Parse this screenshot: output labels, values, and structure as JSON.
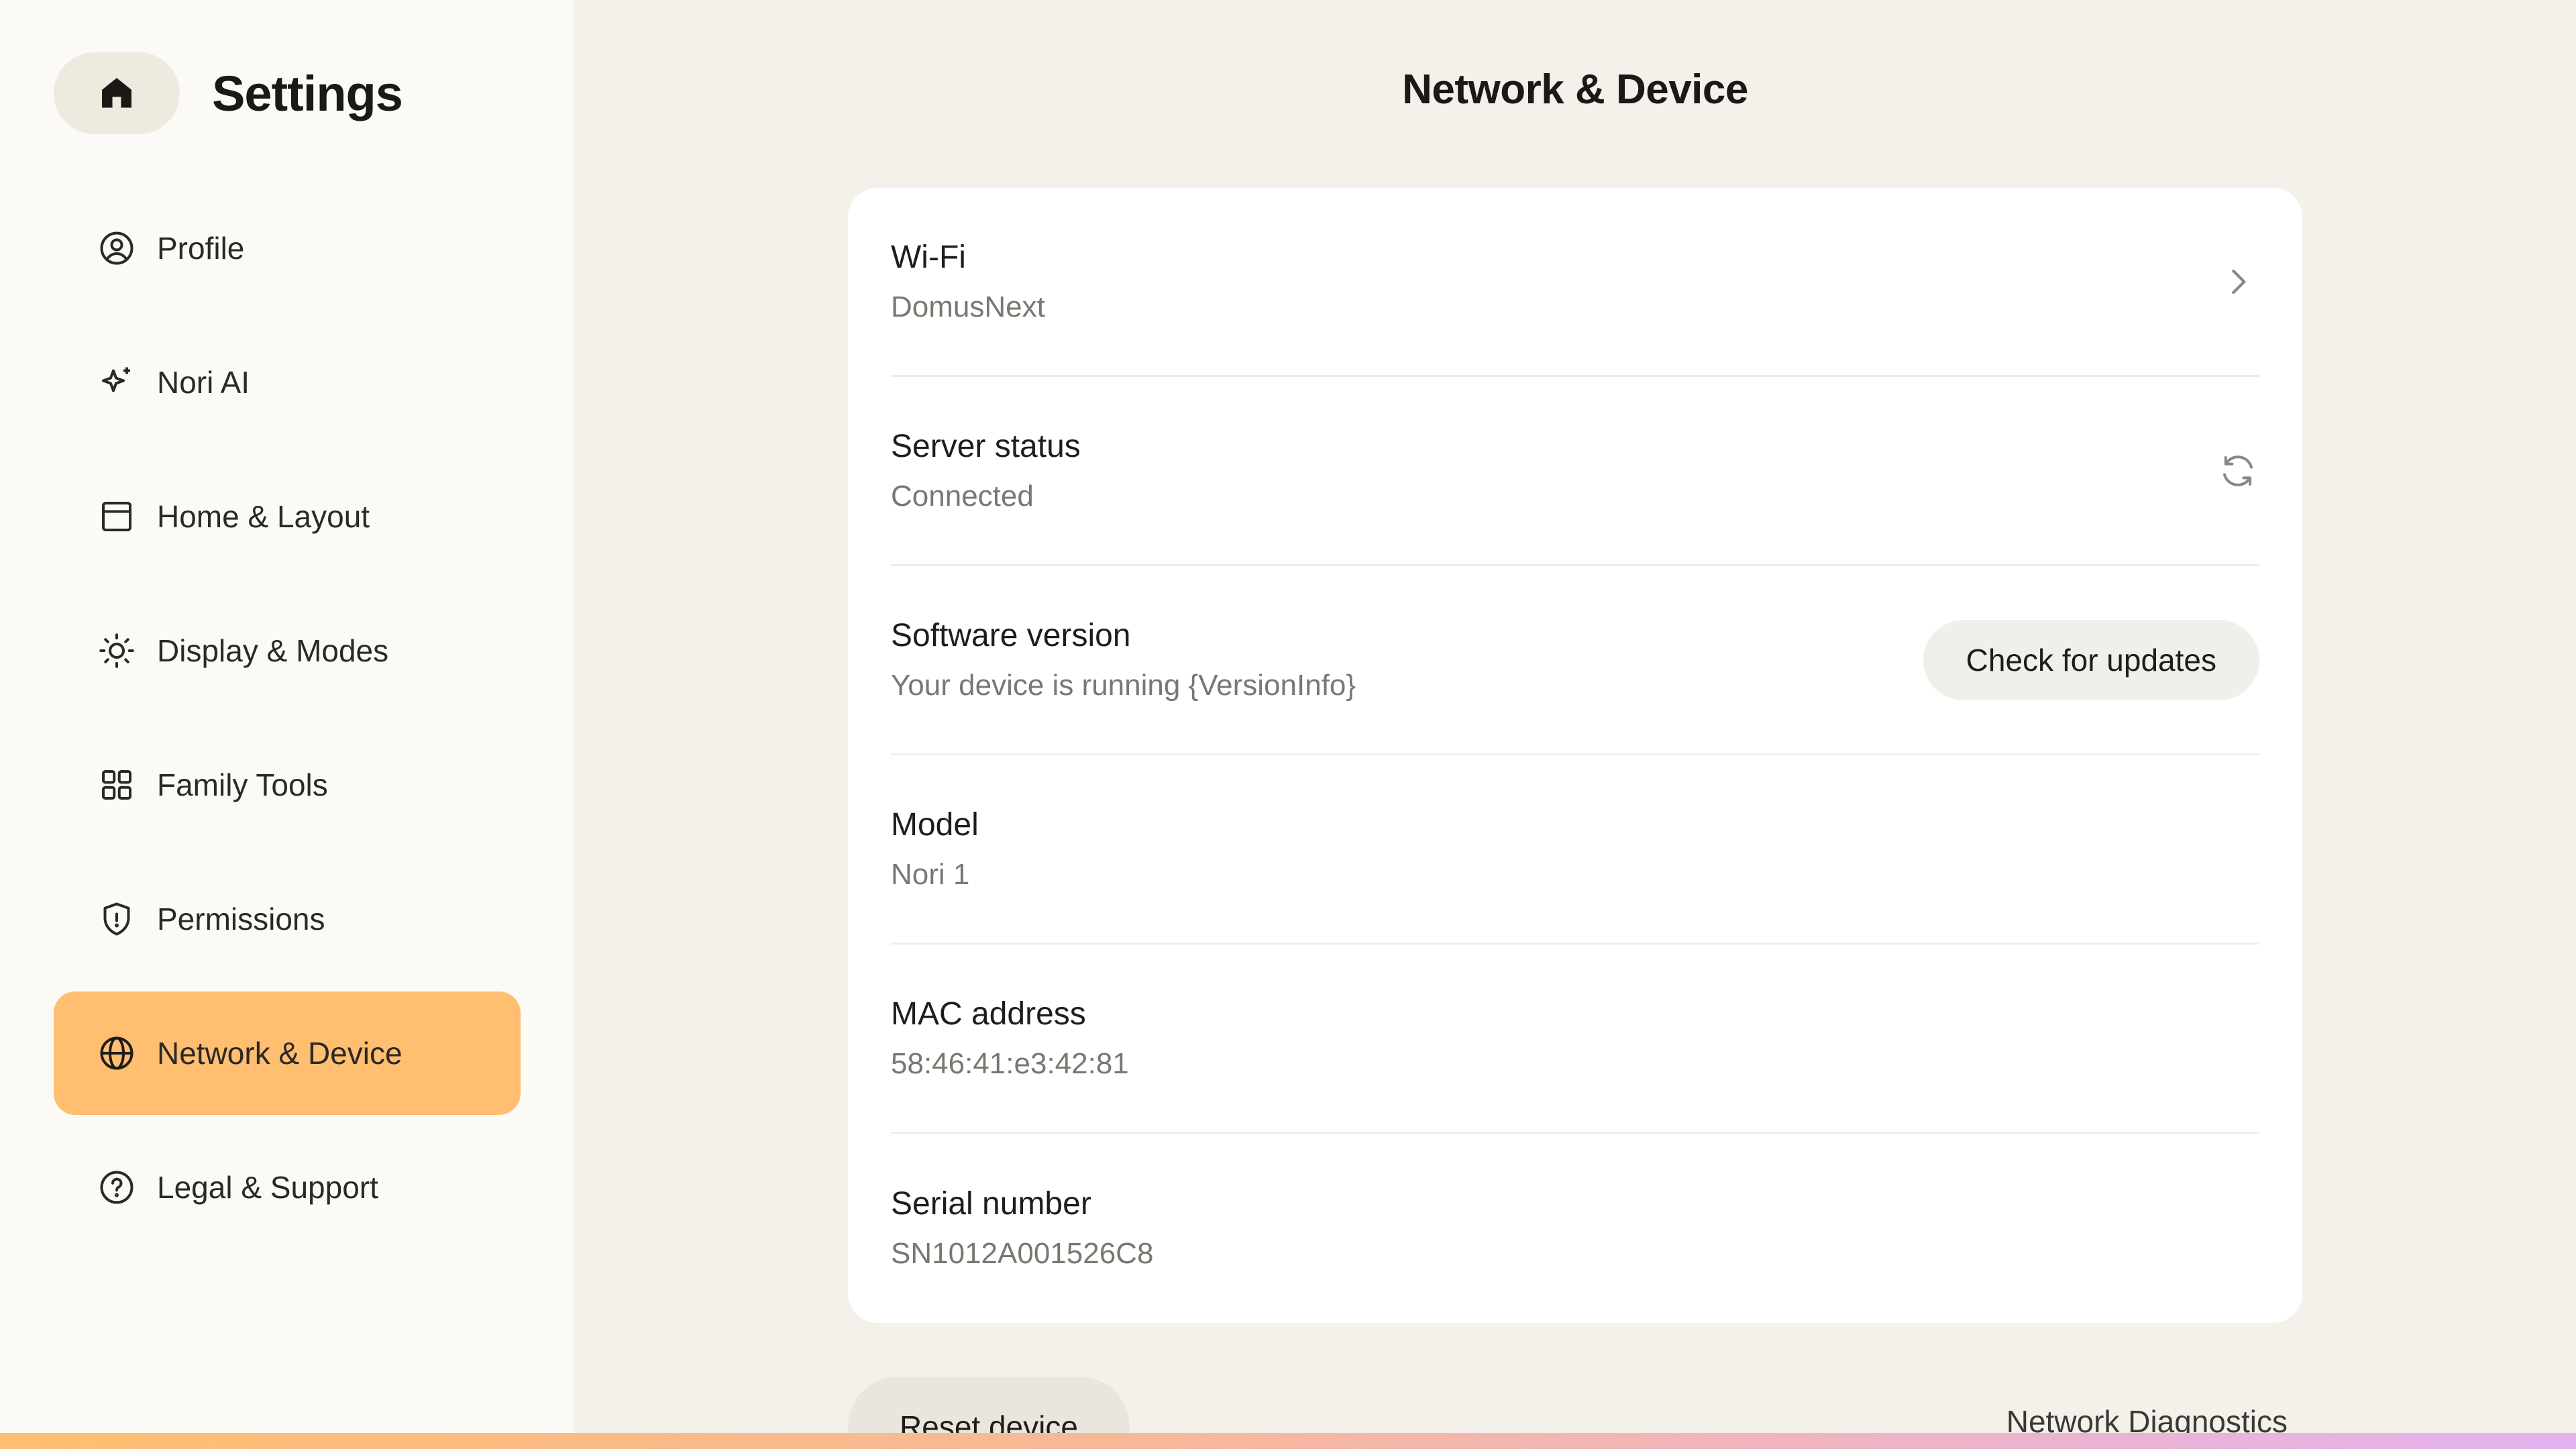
{
  "sidebar": {
    "title": "Settings",
    "home_icon": "home-icon",
    "items": [
      {
        "label": "Profile",
        "icon": "user-circle-icon"
      },
      {
        "label": "Nori AI",
        "icon": "sparkle-icon"
      },
      {
        "label": "Home & Layout",
        "icon": "layout-icon"
      },
      {
        "label": "Display & Modes",
        "icon": "sun-icon"
      },
      {
        "label": "Family Tools",
        "icon": "grid-icon"
      },
      {
        "label": "Permissions",
        "icon": "shield-icon"
      },
      {
        "label": "Network & Device",
        "icon": "globe-icon",
        "active": true
      },
      {
        "label": "Legal & Support",
        "icon": "help-circle-icon"
      }
    ]
  },
  "main": {
    "title": "Network & Device",
    "rows": [
      {
        "title": "Wi-Fi",
        "value": "DomusNext",
        "action": "chevron-right-icon"
      },
      {
        "title": "Server status",
        "value": "Connected",
        "action": "refresh-icon"
      },
      {
        "title": "Software version",
        "value": "Your device is running {VersionInfo}",
        "button": "Check for updates"
      },
      {
        "title": "Model",
        "value": "Nori 1"
      },
      {
        "title": "MAC address",
        "value": "58:46:41:e3:42:81"
      },
      {
        "title": "Serial number",
        "value": "SN1012A001526C8"
      }
    ],
    "reset_label": "Reset device",
    "diagnostics_label": "Network Diagnostics"
  },
  "colors": {
    "accent": "#FFBE70",
    "sidebar_bg": "#FCFAF6",
    "main_bg": "#F4F1EA",
    "card_bg": "#FFFFFF"
  }
}
